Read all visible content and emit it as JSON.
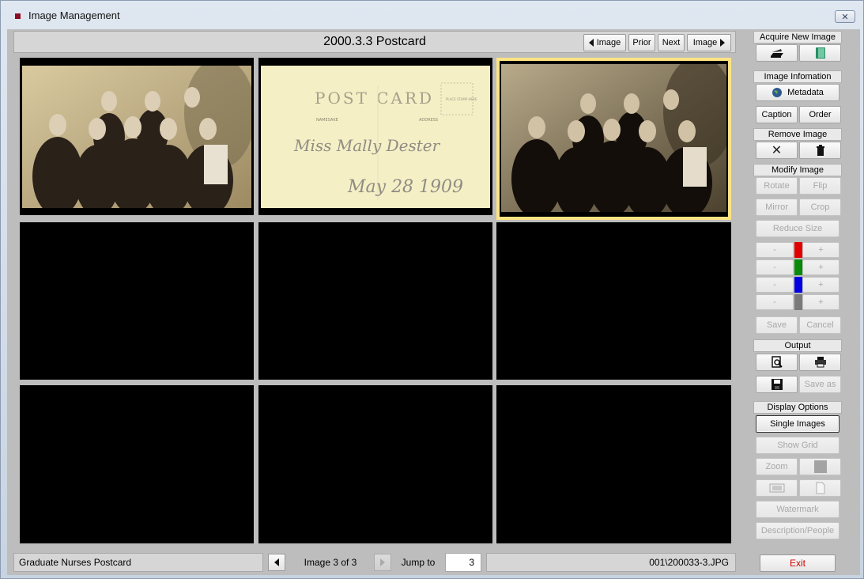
{
  "window": {
    "title": "Image Management",
    "close_icon": "close-icon"
  },
  "header": {
    "title": "2000.3.3 Postcard",
    "first_image": "Image",
    "prior": "Prior",
    "next": "Next",
    "last_image": "Image"
  },
  "postcard": {
    "heading": "POST CARD",
    "left_caption": "NAMESAKE",
    "right_caption": "ADDRESS",
    "stamp_text": "PLACE STAMP HERE",
    "line1": "Miss Mally Dester",
    "line2": "May 28 1909"
  },
  "status": {
    "caption": "Graduate Nurses Postcard",
    "position": "Image 3 of 3",
    "jump_label": "Jump to",
    "jump_value": "3",
    "filename": "001\\200033-3.JPG"
  },
  "panel": {
    "acquire": {
      "label": "Acquire New Image",
      "scan_icon": "scanner-icon",
      "file_icon": "file-open-icon"
    },
    "info": {
      "label": "Image Infomation",
      "metadata": "Metadata",
      "caption": "Caption",
      "order": "Order"
    },
    "remove": {
      "label": "Remove Image",
      "delete_icon": "x-delete-icon",
      "trash_icon": "trash-icon"
    },
    "modify": {
      "label": "Modify Image",
      "rotate": "Rotate",
      "flip": "Flip",
      "mirror": "Mirror",
      "crop": "Crop",
      "reduce": "Reduce Size",
      "minus": "-",
      "plus": "+",
      "save": "Save",
      "cancel": "Cancel",
      "colors": [
        "#e00000",
        "#0a8a0a",
        "#0000e0",
        "#7a7a7a"
      ]
    },
    "output": {
      "label": "Output",
      "preview_icon": "print-preview-icon",
      "print_icon": "printer-icon",
      "save_icon": "floppy-disk-icon",
      "save_as": "Save as"
    },
    "display": {
      "label": "Display Options",
      "single": "Single Images",
      "grid": "Show Grid",
      "zoom": "Zoom",
      "watermark": "Watermark",
      "people": "Description/People"
    },
    "exit": "Exit"
  }
}
